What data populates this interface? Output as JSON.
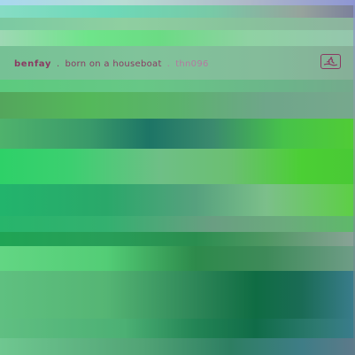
{
  "cover": {
    "artist": "benfay",
    "separator": ".",
    "album": "born on a houseboat",
    "separator2": ".",
    "catalog_number": "thn096",
    "logo_icon": "label-logo-icon",
    "colors": {
      "text": "#8a3a62",
      "text_light": "#b37aa0",
      "green_accent": "#4bcf34",
      "teal_dark": "#0f6c43"
    }
  }
}
